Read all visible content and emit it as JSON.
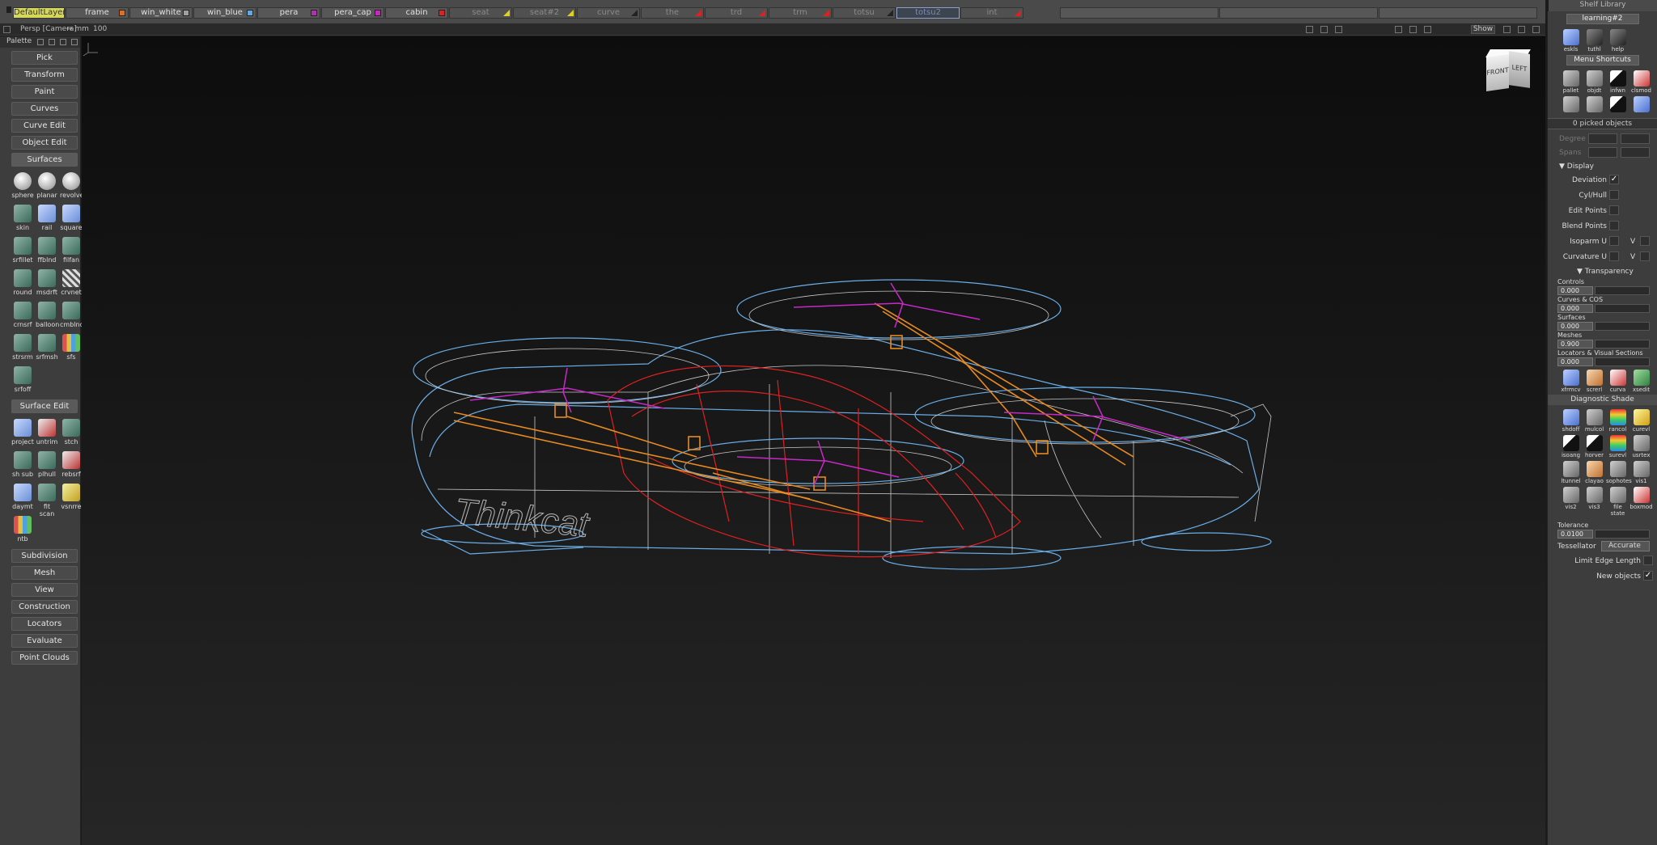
{
  "layers": [
    {
      "label": "DefaultLayer",
      "style": "active",
      "w": 64
    },
    {
      "label": "frame",
      "color": "#e07020",
      "w": 78
    },
    {
      "label": "win_white",
      "color": "#a0a0a0",
      "w": 78
    },
    {
      "label": "win_blue",
      "color": "#60a8e8",
      "w": 78
    },
    {
      "label": "pera",
      "color": "#b030b0",
      "w": 78
    },
    {
      "label": "pera_cap",
      "color": "#d020c8",
      "w": 78
    },
    {
      "label": "cabin",
      "color": "#e02020",
      "w": 78
    },
    {
      "label": "seat",
      "tri": "#e0d020",
      "style": "dim",
      "w": 78
    },
    {
      "label": "seat#2",
      "tri": "#e0d020",
      "style": "dim",
      "w": 78
    },
    {
      "label": "curve",
      "tri": "#222222",
      "style": "dim",
      "w": 78
    },
    {
      "label": "the",
      "tri": "#e02020",
      "style": "dim",
      "w": 78
    },
    {
      "label": "trd",
      "tri": "#e02020",
      "style": "dim",
      "w": 78
    },
    {
      "label": "trm",
      "tri": "#e02020",
      "style": "dim",
      "w": 78
    },
    {
      "label": "totsu",
      "tri": "#222222",
      "style": "dim",
      "w": 78
    },
    {
      "label": "totsu2",
      "style": "sel",
      "w": 78
    },
    {
      "label": "int",
      "tri": "#e02020",
      "style": "dim",
      "w": 78
    }
  ],
  "shelf_header": "Shelf Library",
  "viewport": {
    "camera_label": "Persp [Camera]",
    "units": "↔ mm",
    "zoom": "100",
    "show_button": "Show",
    "viewcube_front": "FRONT",
    "viewcube_left": "LEFT"
  },
  "palette": {
    "title": "Palette",
    "top_buttons": [
      "Pick",
      "Transform",
      "Paint",
      "Curves",
      "Curve Edit",
      "Object Edit"
    ],
    "surfaces_header": "Surfaces",
    "surfaces_tools": [
      {
        "label": "sphere",
        "icon": "sphere-icon",
        "style": "white"
      },
      {
        "label": "planar",
        "icon": "planar-icon",
        "style": "white"
      },
      {
        "label": "revolve",
        "icon": "revolve-icon",
        "style": "white"
      },
      {
        "label": "skin",
        "icon": "skin-icon",
        "style": ""
      },
      {
        "label": "rail",
        "icon": "rail-icon",
        "style": "blue"
      },
      {
        "label": "square",
        "icon": "square-icon",
        "style": "blue"
      },
      {
        "label": "srfillet",
        "icon": "srfillet-icon",
        "style": ""
      },
      {
        "label": "ffblnd",
        "icon": "ffblnd-icon",
        "style": ""
      },
      {
        "label": "filfan",
        "icon": "filfan-icon",
        "style": ""
      },
      {
        "label": "round",
        "icon": "round-icon",
        "style": ""
      },
      {
        "label": "msdrft",
        "icon": "msdrft-icon",
        "style": ""
      },
      {
        "label": "crvnet",
        "icon": "crvnet-icon",
        "style": "grid"
      },
      {
        "label": "crnsrf",
        "icon": "crnsrf-icon",
        "style": ""
      },
      {
        "label": "balloon",
        "icon": "balloon-icon",
        "style": ""
      },
      {
        "label": "cmblnd",
        "icon": "cmblnd-icon",
        "style": ""
      },
      {
        "label": "strsrm",
        "icon": "strsrm-icon",
        "style": ""
      },
      {
        "label": "srfmsh",
        "icon": "srfmsh-icon",
        "style": ""
      },
      {
        "label": "sfs",
        "icon": "sfs-icon",
        "style": "multi"
      },
      {
        "label": "srfoff",
        "icon": "srfoff-icon",
        "style": ""
      }
    ],
    "surface_edit_header": "Surface Edit",
    "surface_edit_tools": [
      {
        "label": "project",
        "icon": "project-icon",
        "style": "blue"
      },
      {
        "label": "untrim",
        "icon": "untrim-icon",
        "style": "red"
      },
      {
        "label": "stch",
        "icon": "stch-icon",
        "style": ""
      },
      {
        "label": "sh sub",
        "icon": "shell-subtract-icon",
        "style": ""
      },
      {
        "label": "plhull",
        "icon": "plhull-icon",
        "style": ""
      },
      {
        "label": "rebsrf",
        "icon": "rebsrf-icon",
        "style": "red"
      },
      {
        "label": "daymt",
        "icon": "daymt-icon",
        "style": "blue"
      },
      {
        "label": "fit scan",
        "icon": "fit-scan-icon",
        "style": ""
      },
      {
        "label": "vsnrre",
        "icon": "vsnrre-icon",
        "style": "yellow"
      },
      {
        "label": "ntb",
        "icon": "ntb-icon",
        "style": "multi"
      }
    ],
    "bottom_buttons": [
      "Subdivision",
      "Mesh",
      "View",
      "Construction",
      "Locators",
      "Evaluate",
      "Point Clouds"
    ]
  },
  "right_panel": {
    "shelf_tab": "learning#2",
    "shelf_icons": [
      {
        "label": "eskls",
        "icon": "sketch-icon",
        "style": "blue"
      },
      {
        "label": "tuthl",
        "icon": "tutorial-icon",
        "style": "dark"
      },
      {
        "label": "help",
        "icon": "help-icon",
        "style": "dark"
      }
    ],
    "menu_shortcuts_tab": "Menu Shortcuts",
    "shortcut_icons": [
      {
        "label": "pallet",
        "icon": "palette-icon",
        "style": ""
      },
      {
        "label": "objdt",
        "icon": "object-detail-icon",
        "style": ""
      },
      {
        "label": "infwn",
        "icon": "info-window-icon",
        "style": "black"
      },
      {
        "label": "clsmod",
        "icon": "clsmod-icon",
        "style": "red"
      }
    ],
    "shortcut_icons_row2": [
      {
        "label": "",
        "icon": "pen-icon",
        "style": ""
      },
      {
        "label": "",
        "icon": "dots-icon",
        "style": ""
      },
      {
        "label": "",
        "icon": "cone-icon",
        "style": "black"
      },
      {
        "label": "",
        "icon": "pattern-icon",
        "style": "blue"
      }
    ],
    "picked": "0 picked objects",
    "degree_label": "Degree",
    "spans_label": "Spans",
    "display_header": "Display",
    "display_rows": [
      {
        "label": "Deviation",
        "checked": "✓"
      },
      {
        "label": "Cyl/Hull",
        "checked": ""
      },
      {
        "label": "Edit Points",
        "checked": ""
      },
      {
        "label": "Blend Points",
        "checked": ""
      },
      {
        "label": "Isoparm U",
        "checked": "",
        "v": "V"
      },
      {
        "label": "Curvature U",
        "checked": "",
        "v": "V"
      }
    ],
    "transparency_header": "Transparency",
    "transparency_rows": [
      {
        "label": "Controls",
        "value": "0.000"
      },
      {
        "label": "Curves & COS",
        "value": "0.000"
      },
      {
        "label": "Surfaces",
        "value": "0.000"
      },
      {
        "label": "Meshes",
        "value": "0.900"
      },
      {
        "label": "Locators & Visual Sections",
        "value": "0.000"
      }
    ],
    "xf_icons": [
      {
        "label": "xfrmcv",
        "icon": "xfrmcv-icon",
        "style": "blue"
      },
      {
        "label": "screrl",
        "icon": "screrl-icon",
        "style": "peach"
      },
      {
        "label": "curva",
        "icon": "curva-icon",
        "style": "red"
      },
      {
        "label": "xsedit",
        "icon": "xsedit-icon",
        "style": "green"
      }
    ],
    "diag_header": "Diagnostic Shade",
    "diag_icons": [
      {
        "label": "shdoff",
        "icon": "shade-off-icon",
        "style": "blue"
      },
      {
        "label": "mulcol",
        "icon": "multi-color-icon",
        "style": ""
      },
      {
        "label": "rancol",
        "icon": "random-color-icon",
        "style": "rainbow"
      },
      {
        "label": "curevl",
        "icon": "curvature-eval-icon",
        "style": "yellow"
      },
      {
        "label": "isoang",
        "icon": "isoangle-icon",
        "style": "black"
      },
      {
        "label": "horver",
        "icon": "horizontal-vertical-icon",
        "style": "black"
      },
      {
        "label": "surevl",
        "icon": "surface-eval-icon",
        "style": "rainbow"
      },
      {
        "label": "usrtex",
        "icon": "user-texture-icon",
        "style": ""
      },
      {
        "label": "ltunnel",
        "icon": "light-tunnel-icon",
        "style": ""
      },
      {
        "label": "clayao",
        "icon": "clay-ao-icon",
        "style": "peach"
      },
      {
        "label": "sophotes",
        "icon": "isophotes-icon",
        "style": ""
      },
      {
        "label": "vis1",
        "icon": "vis1-icon",
        "style": ""
      },
      {
        "label": "vis2",
        "icon": "vis2-icon",
        "style": ""
      },
      {
        "label": "vis3",
        "icon": "vis3-icon",
        "style": ""
      },
      {
        "label": "file state",
        "icon": "file-state-icon",
        "style": ""
      },
      {
        "label": "boxmod",
        "icon": "boxmod-icon",
        "style": "red"
      }
    ],
    "tolerance_label": "Tolerance",
    "tolerance_value": "0.0100",
    "tessellator_label": "Tessellator",
    "tessellator_value": "Accurate",
    "limit_edge_label": "Limit Edge Length",
    "new_objects_label": "New objects",
    "new_objects_checked": "✓"
  },
  "model_logo_text": "Thinkcat",
  "colors": {
    "frame": "#e88a20",
    "cabin": "#e02020",
    "pera": "#c828c8",
    "win_blue": "#6aaee8",
    "white_lines": "#c8c8c8"
  }
}
